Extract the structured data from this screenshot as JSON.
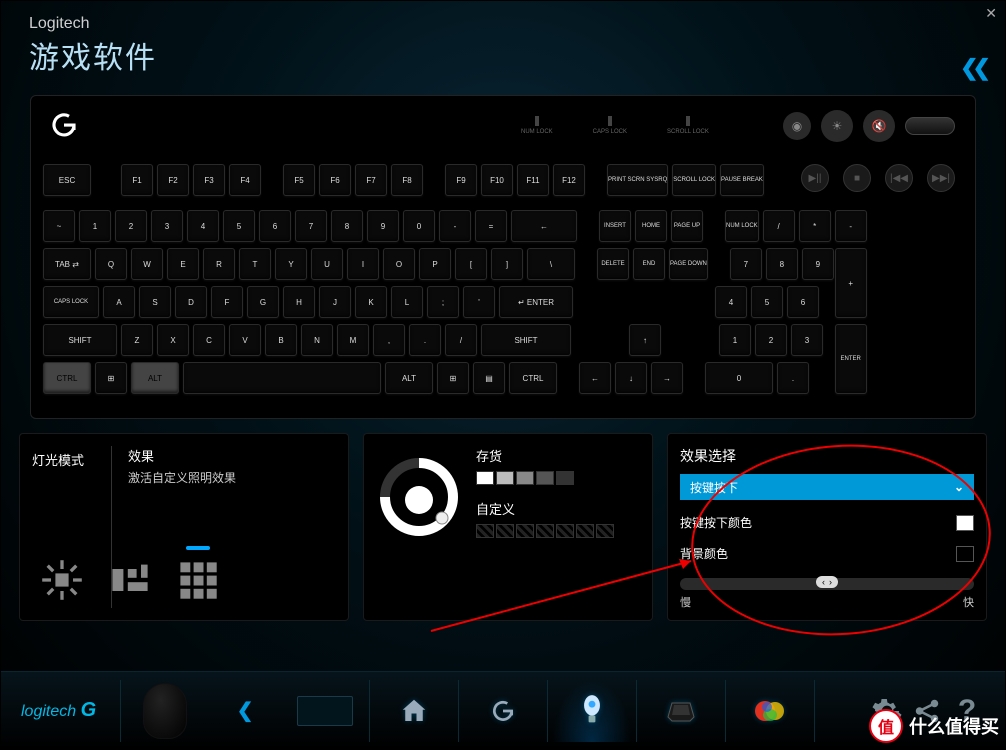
{
  "header": {
    "brand": "Logitech",
    "title": "游戏软件"
  },
  "keyboard": {
    "indicators": [
      "NUM LOCK",
      "CAPS LOCK",
      "SCROLL LOCK"
    ],
    "fnrow": [
      "ESC",
      "F1",
      "F2",
      "F3",
      "F4",
      "F5",
      "F6",
      "F7",
      "F8",
      "F9",
      "F10",
      "F11",
      "F12"
    ],
    "sysrow": [
      "PRINT SCRN SYSRQ",
      "SCROLL LOCK",
      "PAUSE BREAK"
    ],
    "row1": [
      "~",
      "1",
      "2",
      "3",
      "4",
      "5",
      "6",
      "7",
      "8",
      "9",
      "0",
      "-",
      "="
    ],
    "row1_bk": "←",
    "row2_tab": "TAB ⇄",
    "row2": [
      "Q",
      "W",
      "E",
      "R",
      "T",
      "Y",
      "U",
      "I",
      "O",
      "P",
      "[",
      "]",
      "\\"
    ],
    "row3_caps": "CAPS LOCK",
    "row3": [
      "A",
      "S",
      "D",
      "F",
      "G",
      "H",
      "J",
      "K",
      "L",
      ";",
      "'"
    ],
    "row3_enter": "↵ ENTER",
    "row4_shift": "SHIFT",
    "row4": [
      "Z",
      "X",
      "C",
      "V",
      "B",
      "N",
      "M",
      ",",
      ".",
      "/"
    ],
    "row5": [
      "CTRL",
      "⊞",
      "ALT",
      "",
      "ALT",
      "⊞",
      "▤",
      "CTRL"
    ],
    "nav": [
      "INSERT",
      "HOME",
      "PAGE UP",
      "DELETE",
      "END",
      "PAGE DOWN"
    ],
    "arrows": [
      "↑",
      "←",
      "↓",
      "→"
    ],
    "numpad_top": [
      "NUM LOCK",
      "/",
      "*",
      "-"
    ],
    "numpad": [
      "7",
      "8",
      "9",
      "4",
      "5",
      "6",
      "1",
      "2",
      "3",
      "0",
      "."
    ],
    "numpad_plus": "+",
    "numpad_enter": "ENTER"
  },
  "panel1": {
    "left_label": "灯光模式",
    "effect_label": "效果",
    "effect_desc": "激活自定义照明效果"
  },
  "panel2": {
    "stock_label": "存货",
    "custom_label": "自定义",
    "stock_colors": [
      "#ffffff",
      "#bbbbbb",
      "#888888",
      "#555555",
      "#333333"
    ]
  },
  "panel3": {
    "header": "效果选择",
    "dropdown_value": "按键按下",
    "opt1_label": "按键按下颜色",
    "opt1_color": "#ffffff",
    "opt2_label": "背景颜色",
    "opt2_color": "#000000",
    "slider_slow": "慢",
    "slider_fast": "快"
  },
  "watermark": {
    "badge": "值",
    "text": "什么值得买"
  }
}
